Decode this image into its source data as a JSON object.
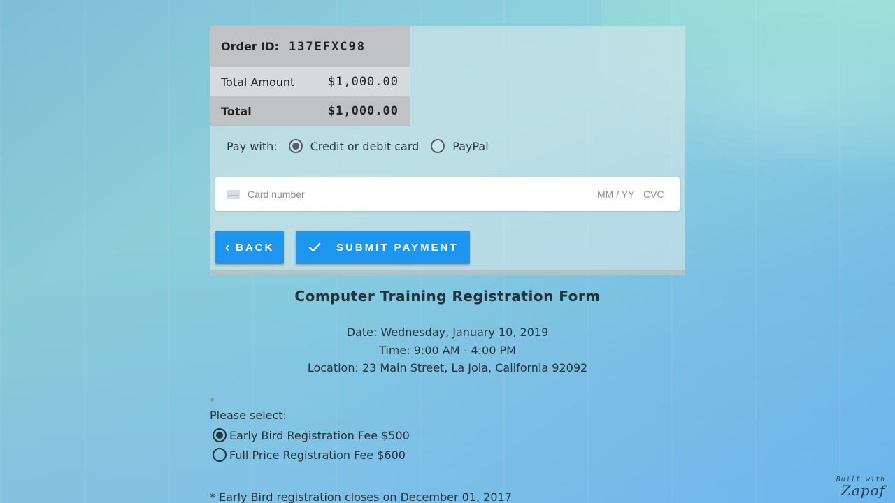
{
  "order": {
    "id_label": "Order ID:",
    "id_value": "137EFXC98",
    "amount_label": "Total Amount",
    "amount_value": "$1,000.00",
    "total_label": "Total",
    "total_value": "$1,000.00"
  },
  "payment": {
    "pay_with_label": "Pay with:",
    "option_card": "Credit or debit card",
    "option_paypal": "PayPal",
    "selected": "card",
    "card_placeholder": "Card number",
    "expiry_placeholder": "MM / YY",
    "cvc_placeholder": "CVC"
  },
  "buttons": {
    "back": "BACK",
    "submit": "SUBMIT PAYMENT"
  },
  "form": {
    "title": "Computer Training Registration Form",
    "date": "Date: Wednesday, January 10, 2019",
    "time": "Time: 9:00 AM - 4:00 PM",
    "location": "Location: 23 Main Street, La Jola, California 92092",
    "required_mark": "*",
    "select_label": "Please select:",
    "options": [
      {
        "label": "Early Bird Registration Fee $500",
        "selected": true
      },
      {
        "label": "Full Price Registration Fee $600",
        "selected": false
      }
    ],
    "note": "* Early Bird registration closes on December 01, 2017"
  },
  "footer": {
    "built_with": "Built with",
    "brand": "Zapof"
  },
  "colors": {
    "button": "#1e95ee",
    "required": "#d9534f"
  },
  "icons": [
    "credit-card-icon",
    "chevron-left-icon",
    "check-icon"
  ]
}
